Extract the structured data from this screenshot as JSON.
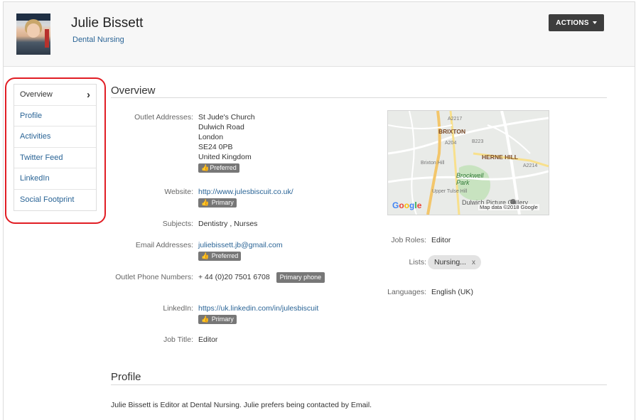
{
  "header": {
    "name": "Julie Bissett",
    "outlet": "Dental Nursing",
    "actions_label": "ACTIONS"
  },
  "sidebar": {
    "items": [
      {
        "label": "Overview"
      },
      {
        "label": "Profile"
      },
      {
        "label": "Activities"
      },
      {
        "label": "Twitter Feed"
      },
      {
        "label": "LinkedIn"
      },
      {
        "label": "Social Footprint"
      }
    ]
  },
  "overview": {
    "title": "Overview",
    "outlet_addresses": {
      "label": "Outlet Addresses:",
      "lines": [
        "St Jude's Church",
        "Dulwich Road",
        "London",
        "SE24 0PB",
        "United Kingdom"
      ],
      "tag": "Preferred"
    },
    "website": {
      "label": "Website:",
      "value": "http://www.julesbiscuit.co.uk/",
      "tag": "Primary"
    },
    "subjects": {
      "label": "Subjects:",
      "value": "Dentistry ,  Nurses"
    },
    "email": {
      "label": "Email Addresses:",
      "value": "juliebissett.jb@gmail.com",
      "tag": "Preferred"
    },
    "phone": {
      "label": "Outlet Phone Numbers:",
      "value": "+ 44 (0)20 7501 6708",
      "tag": "Primary phone"
    },
    "linkedin": {
      "label": "LinkedIn:",
      "value": "https://uk.linkedin.com/in/julesbiscuit",
      "tag": "Primary"
    },
    "job_title": {
      "label": "Job Title:",
      "value": "Editor"
    },
    "job_roles": {
      "label": "Job Roles:",
      "value": "Editor"
    },
    "lists": {
      "label": "Lists:",
      "chip": "Nursing...",
      "remove": "x"
    },
    "languages": {
      "label": "Languages:",
      "value": "English (UK)"
    },
    "map": {
      "labels": {
        "brixton": "BRIXTON",
        "herne_hill": "HERNE HILL",
        "park": "Brockwell Park",
        "dulwich": "Dulwich Picture Gallery",
        "brixton_hill": "Brixton Hill",
        "a2217": "A2217",
        "a204": "A204",
        "b223": "B223",
        "a2214": "A2214",
        "upper_tulse": "Upper Tulse Hill"
      },
      "google": "Google",
      "attribution": "Map data ©2018 Google"
    }
  },
  "profile": {
    "title": "Profile",
    "text": "Julie Bissett is Editor at Dental Nursing. Julie prefers being contacted by Email."
  },
  "colors": {
    "link": "#2a6496",
    "tag_bg": "#777777",
    "highlight_outline": "#e11d24",
    "actions_bg": "#3d3d3d"
  }
}
